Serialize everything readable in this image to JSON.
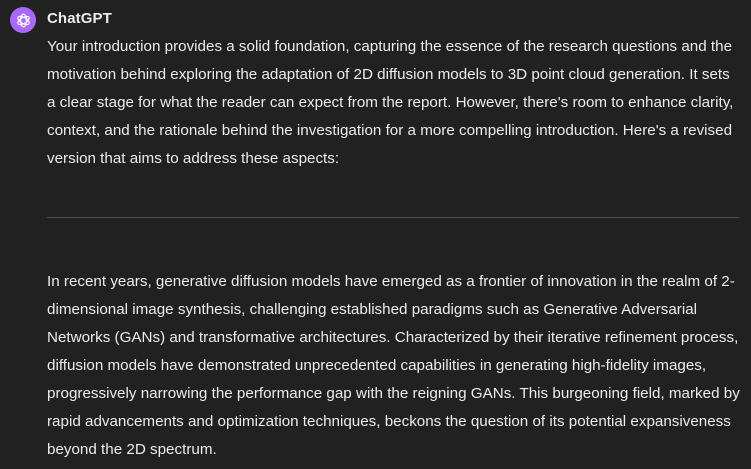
{
  "message": {
    "author": "ChatGPT",
    "avatar_icon": "openai-logo-icon",
    "avatar_color": "#ab68ff",
    "paragraph_1": "Your introduction provides a solid foundation, capturing the essence of the research questions and the motivation behind exploring the adaptation of 2D diffusion models to 3D point cloud generation. It sets a clear stage for what the reader can expect from the report. However, there's room to enhance clarity, context, and the rationale behind the investigation for a more compelling introduction. Here's a revised version that aims to address these aspects:",
    "paragraph_2": "In recent years, generative diffusion models have emerged as a frontier of innovation in the realm of 2-dimensional image synthesis, challenging established paradigms such as Generative Adversarial Networks (GANs) and transformative architectures. Characterized by their iterative refinement process, diffusion models have demonstrated unprecedented capabilities in generating high-fidelity images, progressively narrowing the performance gap with the reigning GANs. This burgeoning field, marked by rapid advancements and optimization techniques, beckons the question of its potential expansiveness beyond the 2D spectrum."
  }
}
